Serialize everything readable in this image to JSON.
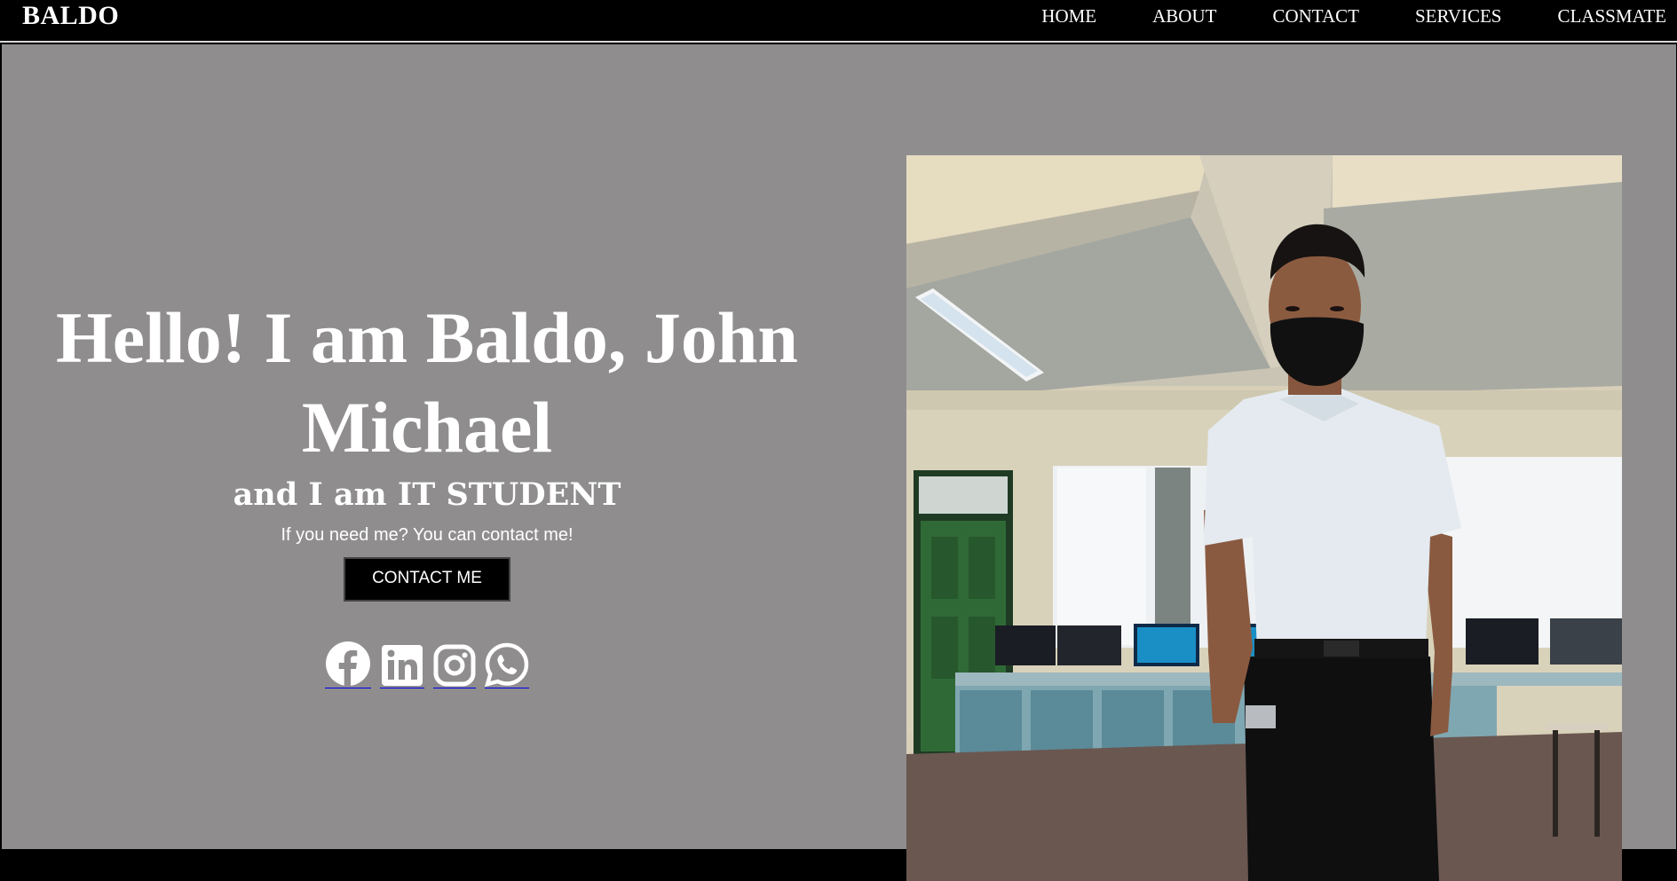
{
  "navbar": {
    "brand": "BALDO",
    "links": [
      {
        "label": "HOME"
      },
      {
        "label": "ABOUT"
      },
      {
        "label": "CONTACT"
      },
      {
        "label": "SERVICES"
      },
      {
        "label": "CLASSMATE"
      }
    ]
  },
  "hero": {
    "headline_line1": "Hello! I am Baldo, John",
    "headline_line2": "Michael",
    "subheadline": "and I am IT STUDENT",
    "tagline": "If you need me? You can contact me!",
    "cta_label": "CONTACT ME",
    "social_icons": [
      "facebook-icon",
      "linkedin-icon",
      "instagram-icon",
      "whatsapp-icon"
    ],
    "photo_alt": "profile-photo"
  },
  "colors": {
    "navbar_bg": "#000000",
    "hero_bg": "#8f8d8e",
    "text": "#ffffff",
    "button_bg": "#000000",
    "link_underline": "#0000ee"
  }
}
